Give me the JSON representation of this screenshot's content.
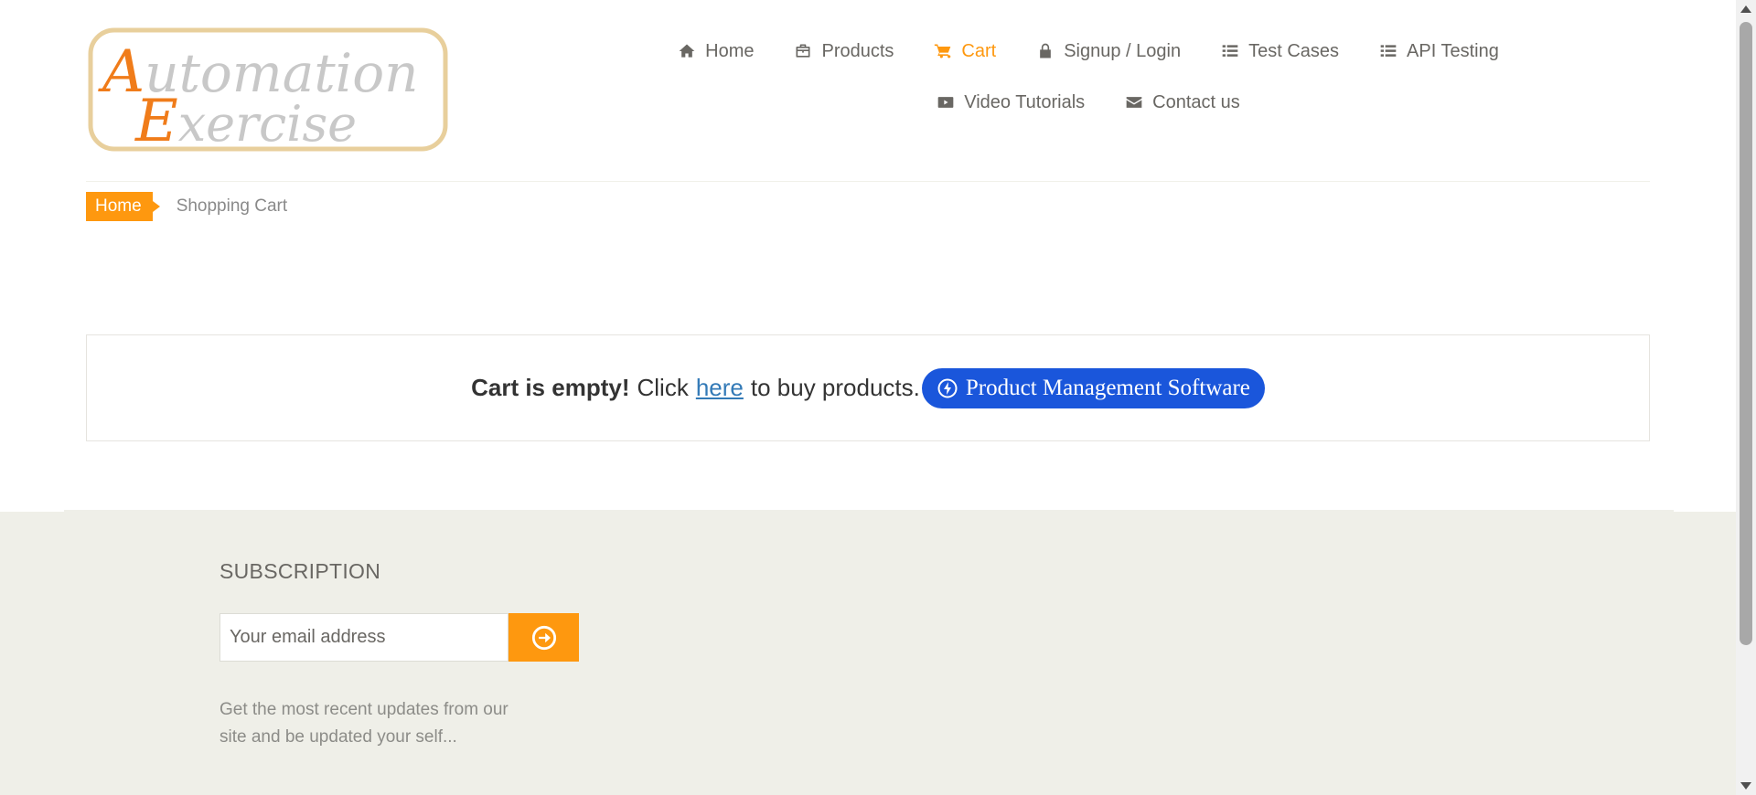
{
  "logo": {
    "line1": "Automation",
    "line2": "Exercise"
  },
  "nav": {
    "items": [
      {
        "label": "Home",
        "icon": "home-icon"
      },
      {
        "label": "Products",
        "icon": "briefcase-icon"
      },
      {
        "label": "Cart",
        "icon": "cart-icon",
        "active": true
      },
      {
        "label": "Signup / Login",
        "icon": "lock-icon"
      },
      {
        "label": "Test Cases",
        "icon": "list-icon"
      },
      {
        "label": "API Testing",
        "icon": "list-icon"
      },
      {
        "label": "Video Tutorials",
        "icon": "youtube-play-icon"
      },
      {
        "label": "Contact us",
        "icon": "envelope-icon"
      }
    ]
  },
  "breadcrumb": {
    "home": "Home",
    "current": "Shopping Cart"
  },
  "cart": {
    "empty_bold": "Cart is empty!",
    "click_text": "Click",
    "link_text": "here",
    "suffix_text": "to buy products.",
    "promo_button": "Product Management Software"
  },
  "footer": {
    "subscription_title": "SUBSCRIPTION",
    "email_placeholder": "Your email address",
    "description": "Get the most recent updates from our site and be updated your self..."
  },
  "colors": {
    "accent": "#fe980f",
    "promo": "#1a56db",
    "footer_bg": "#efefe8",
    "link": "#337ab7"
  }
}
